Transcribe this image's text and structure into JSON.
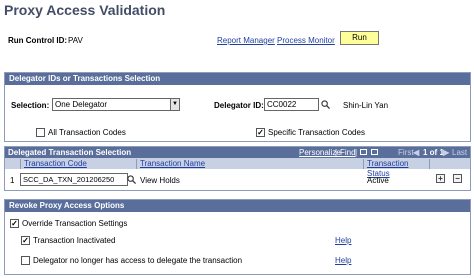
{
  "page": {
    "title": "Proxy Access Validation"
  },
  "header": {
    "run_control_label": "Run Control ID:",
    "run_control_value": "PAV",
    "report_manager": "Report Manager",
    "process_monitor": "Process Monitor",
    "run_label": "Run"
  },
  "delegator_section": {
    "title": "Delegator IDs or Transactions Selection",
    "selection_label": "Selection:",
    "selection_value": "One Delegator",
    "delegator_id_label": "Delegator ID:",
    "delegator_id_value": "CC0022",
    "delegator_name": "Shin-Lin Yan",
    "all_codes_label": "All Transaction Codes",
    "all_codes_checked": false,
    "specific_codes_label": "Specific Transaction Codes",
    "specific_codes_checked": true
  },
  "grid": {
    "title": "Delegated Transaction Selection",
    "personalize": "Personalize",
    "find": "Find",
    "first": "First",
    "range": "1 of 1",
    "last": "Last",
    "columns": [
      "Transaction Code",
      "Transaction Name",
      "Transaction Status"
    ],
    "rows": [
      {
        "num": "1",
        "code": "SCC_DA_TXN_201206250",
        "name": "View Holds",
        "status": "Active"
      }
    ],
    "add_icon": "plus-icon",
    "remove_icon": "minus-icon"
  },
  "revoke_section": {
    "title": "Revoke Proxy Access Options",
    "override_label": "Override Transaction Settings",
    "override_checked": true,
    "inactivated_label": "Transaction Inactivated",
    "inactivated_checked": true,
    "no_access_label": "Delegator no longer has access to delegate the transaction",
    "no_access_checked": false,
    "help1": "Help",
    "help2": "Help"
  }
}
